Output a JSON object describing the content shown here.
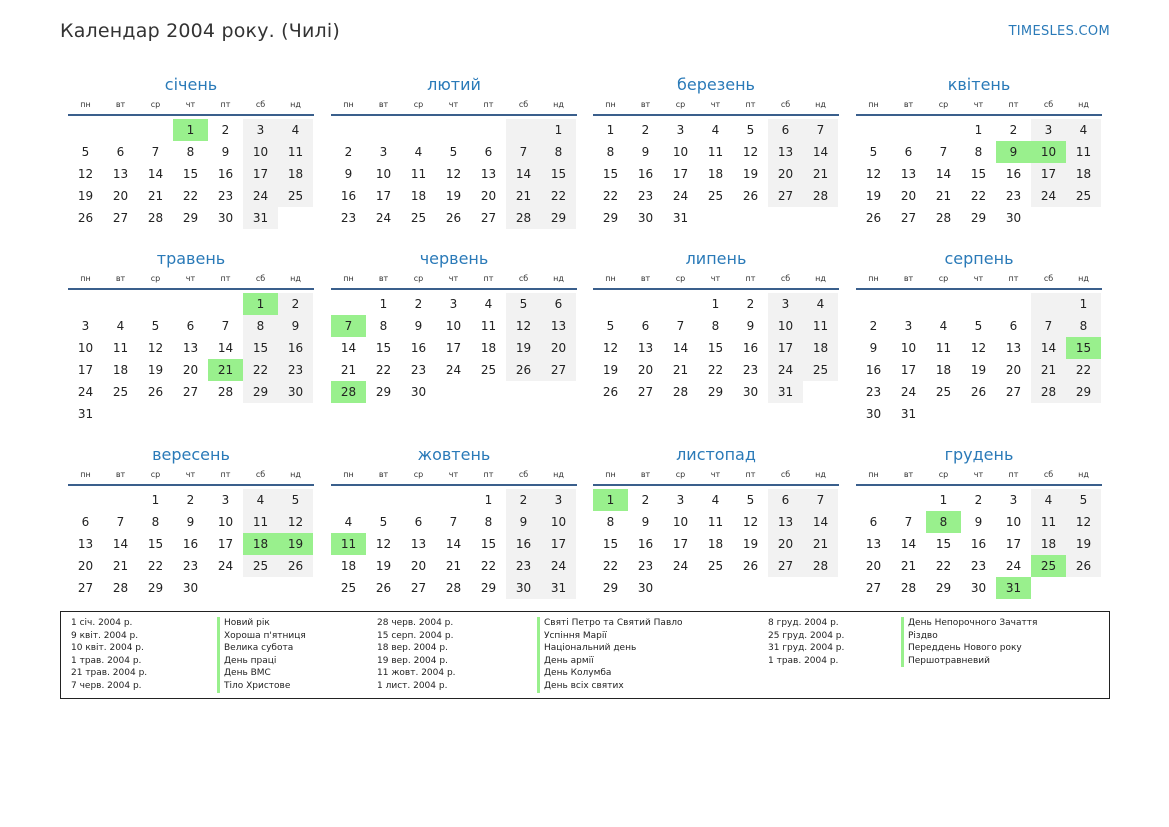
{
  "header": {
    "title": "Календар 2004 року. (Чилі)",
    "site": "TIMESLES.COM"
  },
  "weekdays": [
    "пн",
    "вт",
    "ср",
    "чт",
    "пт",
    "сб",
    "нд"
  ],
  "colors": {
    "accent": "#2a7ab8",
    "holiday": "#99f08d",
    "weekend": "#f2f2f2",
    "rule": "#3a5f8c"
  },
  "months": [
    {
      "name": "січень",
      "offset": 3,
      "days": 31,
      "holidays": [
        1
      ]
    },
    {
      "name": "лютий",
      "offset": 6,
      "days": 29,
      "holidays": []
    },
    {
      "name": "березень",
      "offset": 0,
      "days": 31,
      "holidays": []
    },
    {
      "name": "квітень",
      "offset": 3,
      "days": 30,
      "holidays": [
        9,
        10
      ]
    },
    {
      "name": "травень",
      "offset": 5,
      "days": 31,
      "holidays": [
        1,
        21
      ]
    },
    {
      "name": "червень",
      "offset": 1,
      "days": 30,
      "holidays": [
        7,
        28
      ]
    },
    {
      "name": "липень",
      "offset": 3,
      "days": 31,
      "holidays": []
    },
    {
      "name": "серпень",
      "offset": 6,
      "days": 31,
      "holidays": [
        15
      ]
    },
    {
      "name": "вересень",
      "offset": 2,
      "days": 30,
      "holidays": [
        18,
        19
      ]
    },
    {
      "name": "жовтень",
      "offset": 4,
      "days": 31,
      "holidays": [
        11
      ]
    },
    {
      "name": "листопад",
      "offset": 0,
      "days": 30,
      "holidays": [
        1
      ]
    },
    {
      "name": "грудень",
      "offset": 2,
      "days": 31,
      "holidays": [
        8,
        25,
        31
      ]
    }
  ],
  "holiday_list": [
    {
      "date": "1 січ. 2004 р.",
      "name": "Новий рік"
    },
    {
      "date": "9 квіт. 2004 р.",
      "name": "Хороша п'ятниця"
    },
    {
      "date": "10 квіт. 2004 р.",
      "name": "Велика субота"
    },
    {
      "date": "1 трав. 2004 р.",
      "name": "День праці"
    },
    {
      "date": "21 трав. 2004 р.",
      "name": "День ВМС"
    },
    {
      "date": "7 черв. 2004 р.",
      "name": "Тіло Христове"
    },
    {
      "date": "28 черв. 2004 р.",
      "name": "Святі Петро та Святий Павло"
    },
    {
      "date": "15 серп. 2004 р.",
      "name": "Успіння Марії"
    },
    {
      "date": "18 вер. 2004 р.",
      "name": "Національний день"
    },
    {
      "date": "19 вер. 2004 р.",
      "name": "День армії"
    },
    {
      "date": "11 жовт. 2004 р.",
      "name": "День Колумба"
    },
    {
      "date": "1 лист. 2004 р.",
      "name": "День всіх святих"
    },
    {
      "date": "8 груд. 2004 р.",
      "name": "День Непорочного Зачаття"
    },
    {
      "date": "25 груд. 2004 р.",
      "name": "Різдво"
    },
    {
      "date": "31 груд. 2004 р.",
      "name": "Переддень Нового року"
    },
    {
      "date": "1 трав. 2004 р.",
      "name": "Першотравневий"
    }
  ]
}
